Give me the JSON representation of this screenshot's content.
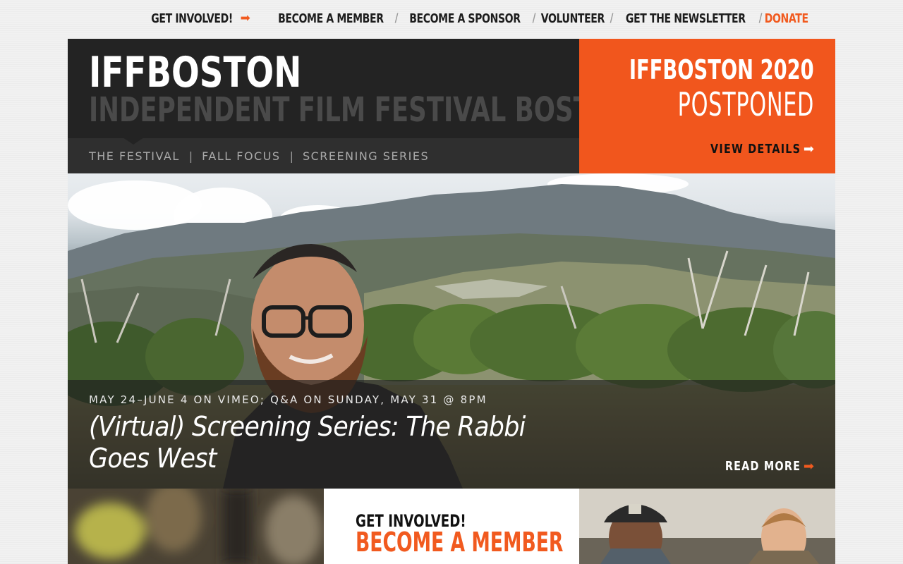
{
  "topnav": {
    "get_involved": "GET INVOLVED!",
    "become_member": "BECOME A MEMBER",
    "become_sponsor": "BECOME A SPONSOR",
    "volunteer": "VOLUNTEER",
    "newsletter": "GET THE NEWSLETTER",
    "donate": "DONATE",
    "separator": "/"
  },
  "header": {
    "logo_main": "IFFBOSTON",
    "logo_sub": "INDEPENDENT FILM FESTIVAL BOSTON",
    "subnav": [
      "THE FESTIVAL",
      "FALL FOCUS",
      "SCREENING SERIES"
    ],
    "divider": "|"
  },
  "promo": {
    "line1": "IFFBOSTON 2020",
    "line2": "POSTPONED",
    "link": "VIEW DETAILS"
  },
  "hero": {
    "date": "MAY 24–JUNE 4 ON VIMEO; Q&A ON SUNDAY, MAY 31 @ 8PM",
    "title": "(Virtual) Screening Series: The Rabbi Goes West",
    "link": "READ MORE"
  },
  "bottom": {
    "kicker": "GET INVOLVED!",
    "heading": "BECOME A MEMBER"
  },
  "colors": {
    "accent": "#f15a1f",
    "header_bg": "#232323",
    "subnav_bg": "#2f2f2f"
  },
  "icons": {
    "arrow": "arrow-right-icon"
  }
}
